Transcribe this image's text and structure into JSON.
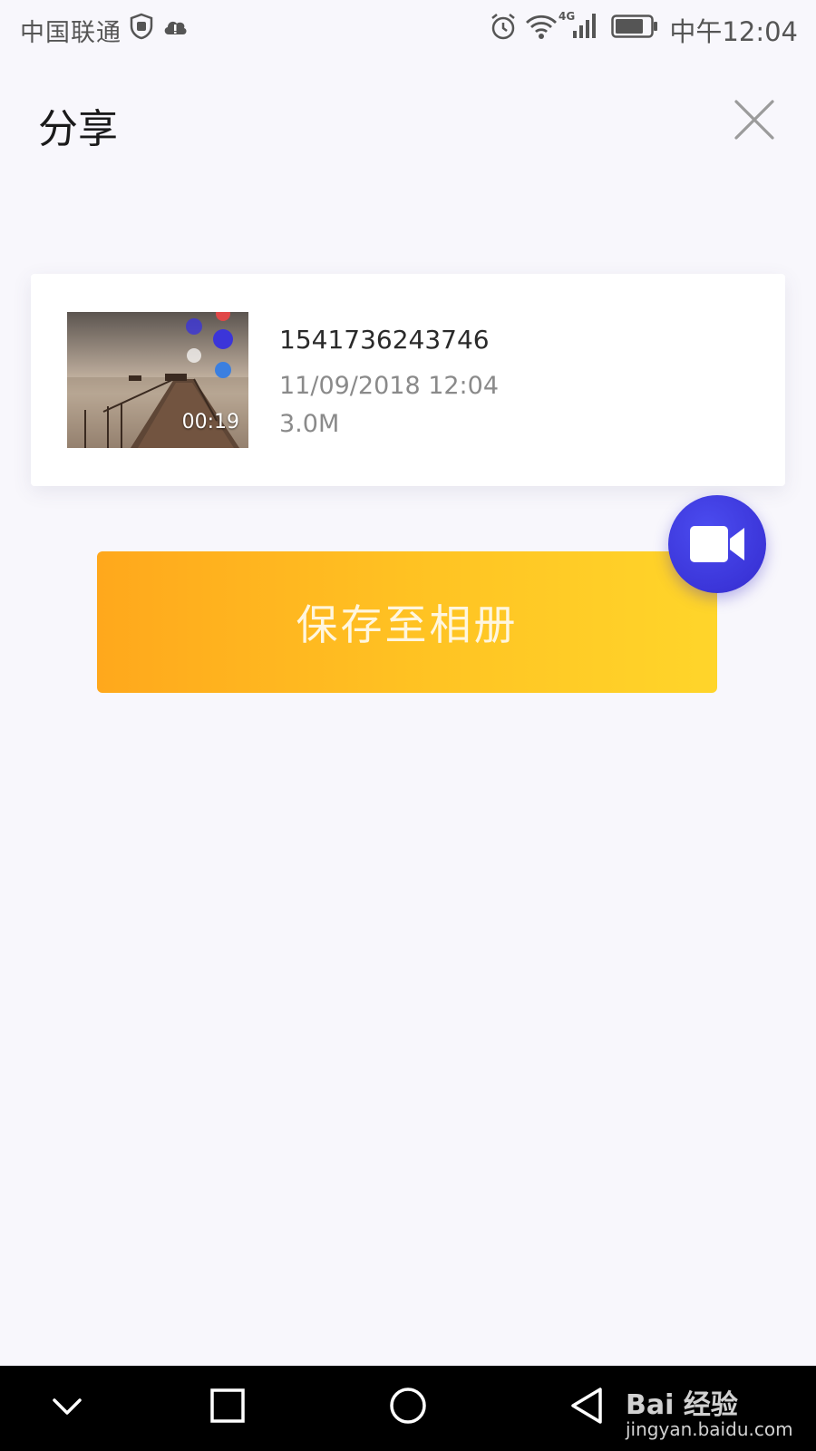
{
  "status_bar": {
    "carrier": "中国联通",
    "network": "4G",
    "time": "中午12:04",
    "icons": [
      "shield-icon",
      "cloud-icon",
      "alarm-icon",
      "wifi-icon",
      "signal-icon",
      "battery-icon"
    ]
  },
  "header": {
    "title": "分享",
    "close_icon": "close-icon"
  },
  "file": {
    "name": "1541736243746",
    "date": "11/09/2018 12:04",
    "size": "3.0M",
    "duration": "00:19"
  },
  "actions": {
    "save_label": "保存至相册",
    "record_icon": "video-camera-icon"
  },
  "nav_bar": {
    "buttons": [
      "chevron-down-icon",
      "square-icon",
      "circle-icon",
      "triangle-back-icon"
    ]
  },
  "watermark": {
    "brand": "Bai 经验",
    "domain": "jingyan.baidu.com"
  },
  "colors": {
    "accent_gradient_start": "#ffa81c",
    "accent_gradient_end": "#ffd52a",
    "fab": "#3b35d9",
    "background": "#f8f7fc"
  }
}
